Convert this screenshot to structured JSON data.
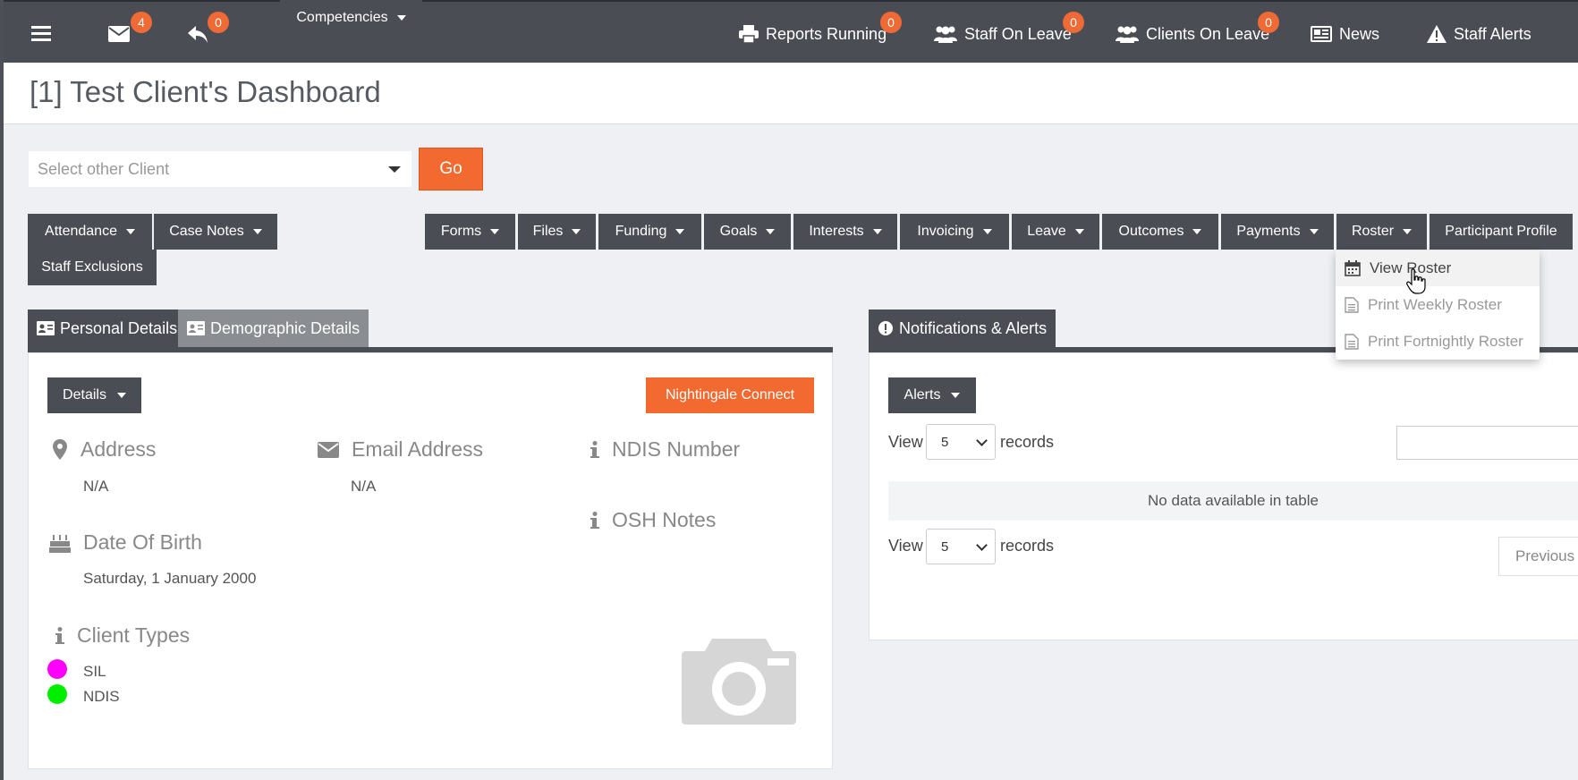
{
  "topbar": {
    "mail_badge": "4",
    "reply_badge": "0",
    "reports_running": "Reports Running",
    "reports_badge": "0",
    "staff_on_leave": "Staff On Leave",
    "staff_leave_badge": "0",
    "clients_on_leave": "Clients On Leave",
    "clients_leave_badge": "0",
    "news": "News",
    "staff_alerts": "Staff Alerts"
  },
  "header": {
    "title": "[1] Test Client's Dashboard"
  },
  "client_select": {
    "placeholder": "Select other Client",
    "go_label": "Go"
  },
  "menu": {
    "items": [
      {
        "label": "Attendance"
      },
      {
        "label": "Case Notes"
      },
      {
        "label": "Competencies"
      },
      {
        "label": "Forms"
      },
      {
        "label": "Files"
      },
      {
        "label": "Funding"
      },
      {
        "label": "Goals"
      },
      {
        "label": "Interests"
      },
      {
        "label": "Invoicing"
      },
      {
        "label": "Leave"
      },
      {
        "label": "Outcomes"
      },
      {
        "label": "Payments"
      },
      {
        "label": "Roster"
      },
      {
        "label": "Participant Profile"
      },
      {
        "label": "Staff Exclusions"
      }
    ]
  },
  "roster_dropdown": {
    "items": [
      "View Roster",
      "Print Weekly Roster",
      "Print Fortnightly Roster"
    ]
  },
  "personal_panel": {
    "tab_personal": "Personal Details",
    "tab_demographic": "Demographic Details",
    "details_label": "Details",
    "nightingale_label": "Nightingale Connect",
    "address_label": "Address",
    "address_value": "N/A",
    "email_label": "Email Address",
    "email_value": "N/A",
    "ndis_label": "NDIS Number",
    "osh_label": "OSH Notes",
    "dob_label": "Date Of Birth",
    "dob_value": "Saturday, 1 January 2000",
    "client_types_label": "Client Types",
    "client_types": [
      {
        "name": "SIL",
        "color": "#ff00ff"
      },
      {
        "name": "NDIS",
        "color": "#00ee00"
      }
    ]
  },
  "notifications_panel": {
    "tab_label": "Notifications & Alerts",
    "alerts_label": "Alerts",
    "view_label": "View",
    "records_label": "records",
    "page_size": "5",
    "empty_text": "No data available in table",
    "previous_label": "Previous"
  },
  "colors": {
    "accent": "#f26a30",
    "dark": "#4a4e54",
    "badge": "#f06a35"
  }
}
